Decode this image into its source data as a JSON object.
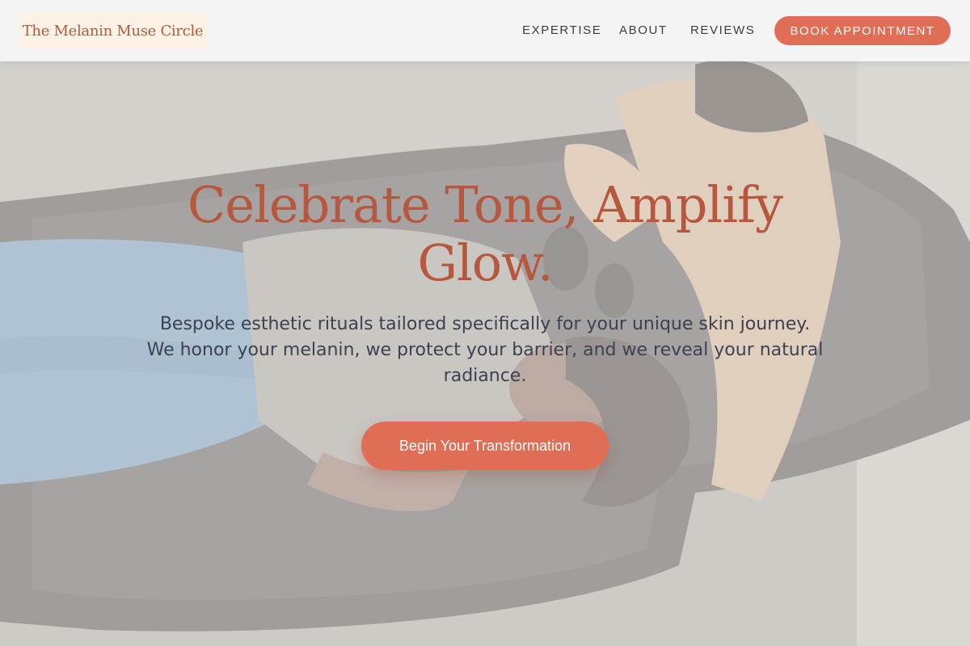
{
  "brand": {
    "logo_text": "The Melanin Muse Circle"
  },
  "nav": {
    "items": [
      {
        "label": "EXPERTISE"
      },
      {
        "label": "ABOUT"
      },
      {
        "label": "REVIEWS"
      }
    ],
    "book_label": "BOOK APPOINTMENT"
  },
  "hero": {
    "headline_line1": "Celebrate Tone, Amplify",
    "headline_line2": "Glow.",
    "subtext_line1": "Bespoke esthetic rituals tailored specifically for your unique skin journey.",
    "subtext_line2": "We honor your melanin, we protect your barrier, and we reveal your natural",
    "subtext_line3": "radiance.",
    "cta_label": "Begin Your Transformation"
  },
  "colors": {
    "accent": "#e06e55",
    "headline": "#b6583f",
    "logo_bg": "#fdf2e3",
    "body_text": "#3b4252"
  }
}
